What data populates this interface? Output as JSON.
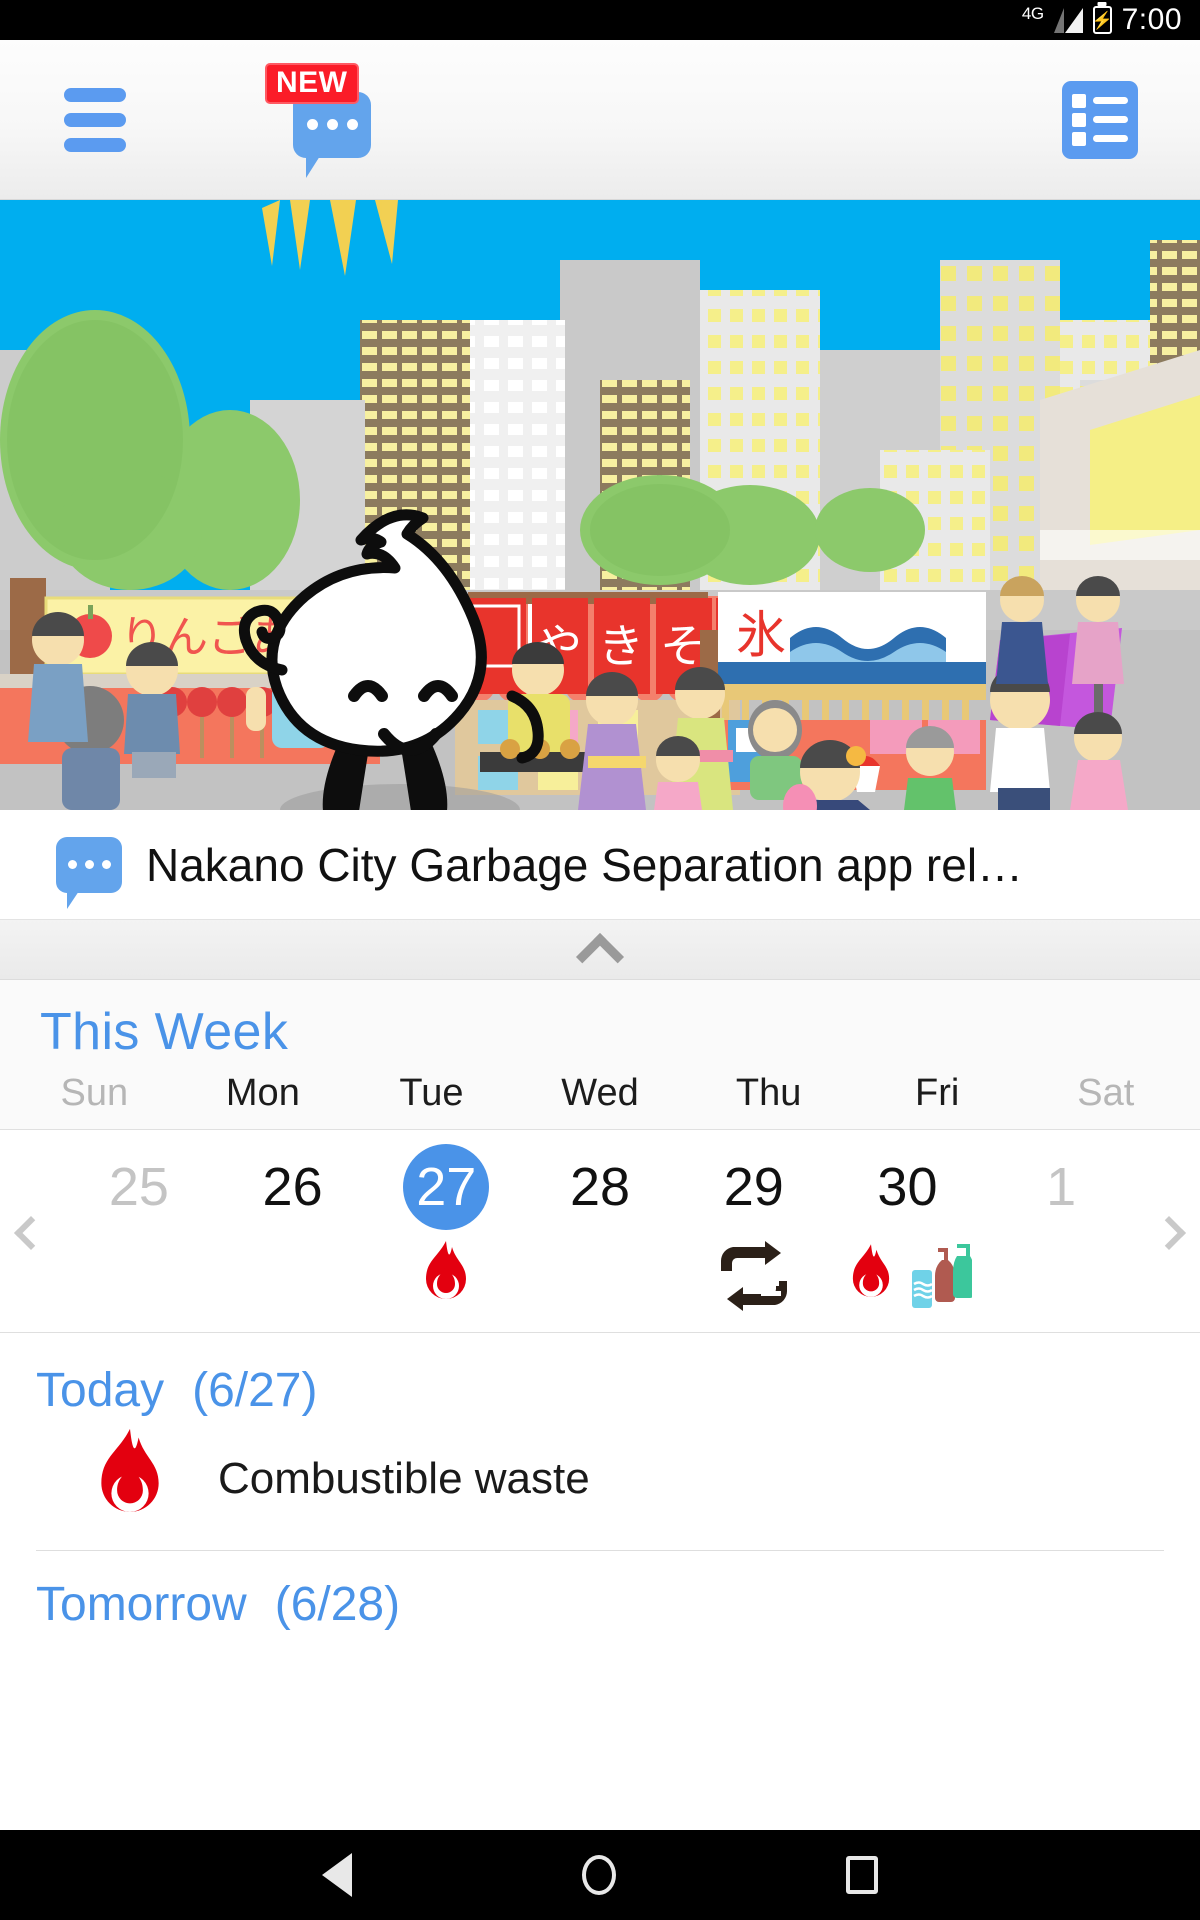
{
  "status_bar": {
    "network": "4G",
    "battery_icon": "battery-charging-icon",
    "signal_icon": "signal-bars-icon",
    "time": "7:00"
  },
  "header": {
    "menu_icon": "hamburger-menu-icon",
    "chat_icon": "chat-bubble-icon",
    "new_badge": "NEW",
    "list_icon": "list-view-icon"
  },
  "hero": {
    "alt": "Japanese summer festival street scene with food stalls and Nakano City mascot",
    "stall_signs": [
      "りんごあめ",
      "やきそば",
      "氷"
    ],
    "sky_color": "#00aeef"
  },
  "news": {
    "icon": "chat-bubble-icon",
    "headline": "Nakano City Garbage Separation app rel…"
  },
  "collapse": {
    "icon": "chevron-up-icon"
  },
  "week": {
    "title": "This Week",
    "prev_icon": "chevron-left-icon",
    "next_icon": "chevron-right-icon",
    "days": [
      {
        "dow": "Sun",
        "date": "25",
        "muted": true,
        "today": false,
        "icons": []
      },
      {
        "dow": "Mon",
        "date": "26",
        "muted": false,
        "today": false,
        "icons": []
      },
      {
        "dow": "Tue",
        "date": "27",
        "muted": false,
        "today": true,
        "icons": [
          "flame-icon"
        ]
      },
      {
        "dow": "Wed",
        "date": "28",
        "muted": false,
        "today": false,
        "icons": []
      },
      {
        "dow": "Thu",
        "date": "29",
        "muted": false,
        "today": false,
        "icons": [
          "plastic-recycle-icon"
        ]
      },
      {
        "dow": "Fri",
        "date": "30",
        "muted": false,
        "today": false,
        "icons": [
          "flame-icon",
          "bottles-cans-icon"
        ]
      },
      {
        "dow": "Sat",
        "date": "1",
        "muted": true,
        "today": false,
        "icons": []
      }
    ]
  },
  "schedule": {
    "today": {
      "label": "Today",
      "date": "(6/27)",
      "items": [
        {
          "icon": "flame-icon",
          "name": "Combustible waste"
        }
      ]
    },
    "tomorrow": {
      "label": "Tomorrow",
      "date": "(6/28)",
      "items": []
    }
  },
  "nav_bar": {
    "back_icon": "nav-back-icon",
    "home_icon": "nav-home-icon",
    "recents_icon": "nav-recents-icon"
  },
  "colors": {
    "accent_blue": "#4a93e8",
    "icon_blue": "#5b9bf0",
    "badge_red": "#fb1c28",
    "flame_red": "#e3000f"
  }
}
